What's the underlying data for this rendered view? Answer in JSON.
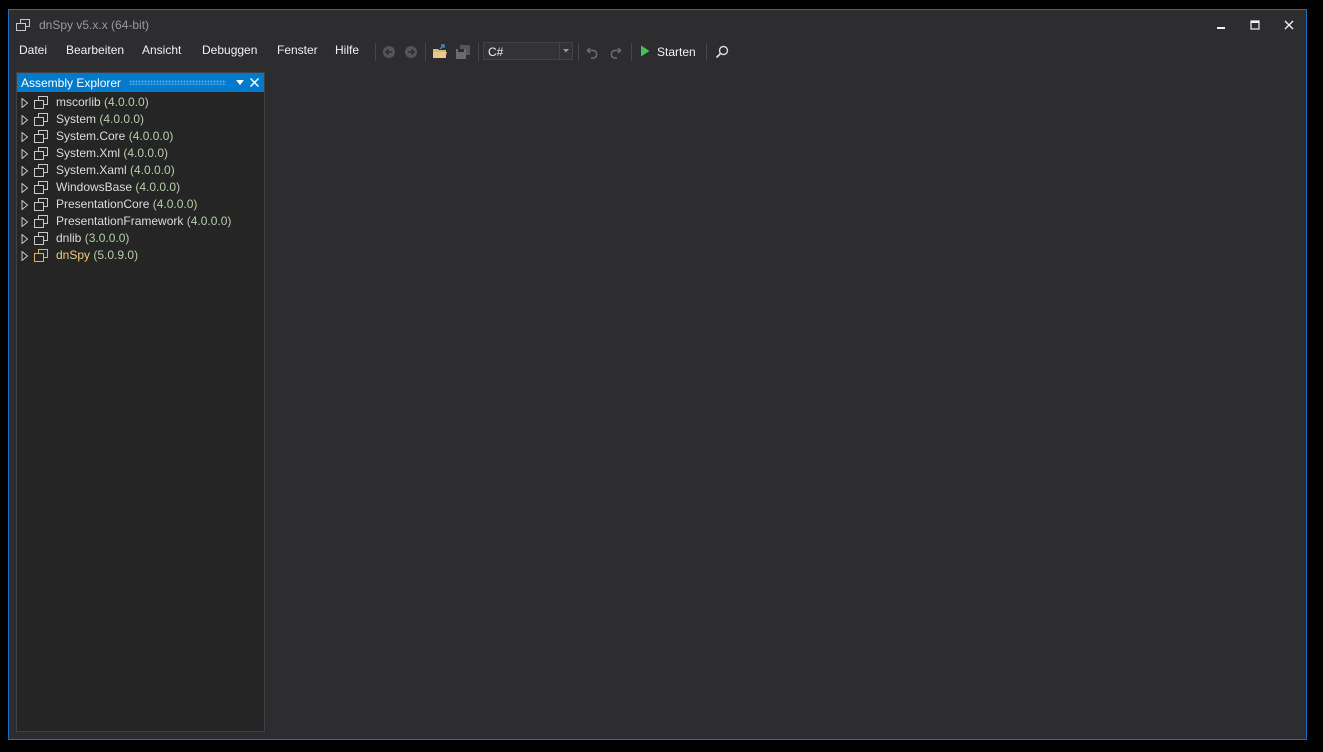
{
  "window": {
    "title": "dnSpy v5.x.x (64-bit)",
    "accent_color": "#007acc",
    "border_color": "#1a6fc4"
  },
  "menu": {
    "items": [
      "Datei",
      "Bearbeiten",
      "Ansicht",
      "Debuggen",
      "Fenster",
      "Hilfe"
    ]
  },
  "toolbar": {
    "language": "C#",
    "start_label": "Starten",
    "icons": [
      "back-icon",
      "forward-icon",
      "open-icon",
      "save-all-icon",
      "undo-icon",
      "redo-icon",
      "start-icon",
      "search-icon"
    ]
  },
  "assembly_explorer": {
    "title": "Assembly Explorer",
    "items": [
      {
        "name": "mscorlib",
        "version": "(4.0.0.0)"
      },
      {
        "name": "System",
        "version": "(4.0.0.0)"
      },
      {
        "name": "System.Core",
        "version": "(4.0.0.0)"
      },
      {
        "name": "System.Xml",
        "version": "(4.0.0.0)"
      },
      {
        "name": "System.Xaml",
        "version": "(4.0.0.0)"
      },
      {
        "name": "WindowsBase",
        "version": "(4.0.0.0)"
      },
      {
        "name": "PresentationCore",
        "version": "(4.0.0.0)"
      },
      {
        "name": "PresentationFramework",
        "version": "(4.0.0.0)"
      },
      {
        "name": "dnlib",
        "version": "(3.0.0.0)"
      },
      {
        "name": "dnSpy",
        "version": "(5.0.9.0)",
        "highlighted": true
      }
    ]
  }
}
